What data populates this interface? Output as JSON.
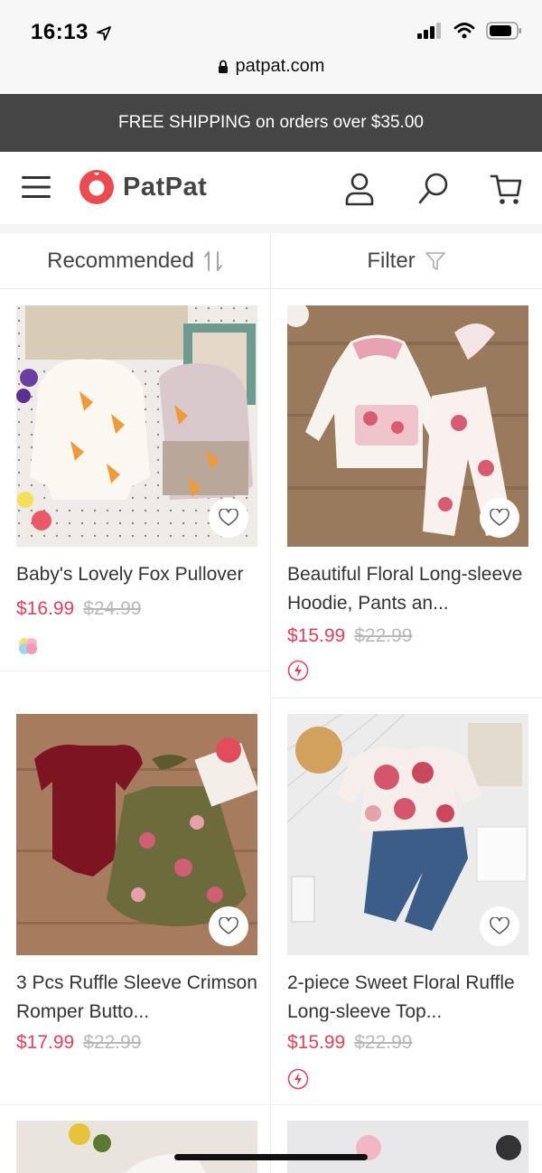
{
  "status": {
    "time": "16:13"
  },
  "browser": {
    "url": "patpat.com"
  },
  "promo": {
    "text": "FREE SHIPPING on orders over $35.00"
  },
  "header": {
    "logo": "PatPat"
  },
  "sortbar": {
    "sort_label": "Recommended",
    "filter_label": "Filter"
  },
  "colors": {
    "accent": "#e0415b",
    "banner": "#454545"
  },
  "products": [
    {
      "title": "Baby's Lovely Fox Pullover",
      "price": "$16.99",
      "original_price": "$24.99"
    },
    {
      "title": "Beautiful Floral Long-sleeve Hoodie, Pants an...",
      "price": "$15.99",
      "original_price": "$22.99"
    },
    {
      "title": "3 Pcs Ruffle Sleeve Crimson Romper Butto...",
      "price": "$17.99",
      "original_price": "$22.99"
    },
    {
      "title": "2-piece Sweet Floral Ruffle Long-sleeve Top...",
      "price": "$15.99",
      "original_price": "$22.99"
    }
  ]
}
